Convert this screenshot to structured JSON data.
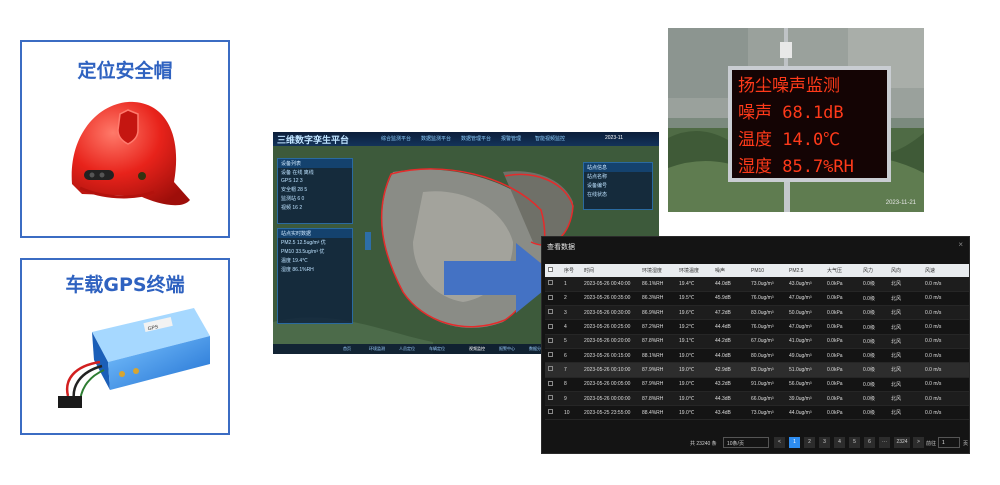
{
  "cards": {
    "helmet_title": "定位安全帽",
    "gps_title": "车载GPS终端",
    "gps_device_label": "GPS"
  },
  "platform": {
    "title": "三维数字孪生平台",
    "nav_tabs": [
      "综合监测平台",
      "数据监测平台",
      "数据管理平台",
      "报警管理",
      "智能视频监控"
    ],
    "date": "2023-11",
    "left_panel_title": "设备列表",
    "left_panel_rows": [
      "设备  在线  离线",
      "GPS  12  3",
      "安全帽  28  5",
      "监测站  6  0",
      "视频  16  2"
    ],
    "left_panel2_title": "站点实时数据",
    "left_panel2_rows": [
      "PM2.5  12.5ug/m³  优",
      "PM10  33.5ug/m³  优",
      "温度  19.4℃",
      "湿度  86.1%RH"
    ],
    "right_panel_title": "站点信息",
    "right_panel_rows": [
      "站点名称",
      "设备编号",
      "在线状态"
    ],
    "bottom_tabs": [
      "首页",
      "环境监测",
      "人员定位",
      "车辆定位",
      "视频监控",
      "报警中心",
      "数据分析"
    ]
  },
  "monitor": {
    "led_lines": [
      "扬尘噪声监测",
      "噪声  68.1dB",
      "温度  14.0℃",
      "湿度  85.7%RH"
    ],
    "watermark": "2023-11-21"
  },
  "datawin": {
    "title": "查看数据",
    "close_icon": "×",
    "columns": [
      "序号",
      "时间",
      "环境湿度",
      "环境温度",
      "噪声",
      "PM10",
      "PM2.5",
      "大气压",
      "风力",
      "风向",
      "风速"
    ],
    "rows": [
      [
        "1",
        "2023-05-26 00:40:00",
        "86.1%RH",
        "19.4℃",
        "44.0dB",
        "73.0ug/m³",
        "43.0ug/m³",
        "0.0kPa",
        "0.0级",
        "北风",
        "0.0 m/s"
      ],
      [
        "2",
        "2023-05-26 00:35:00",
        "86.3%RH",
        "19.5℃",
        "45.9dB",
        "76.0ug/m³",
        "47.0ug/m³",
        "0.0kPa",
        "0.0级",
        "北风",
        "0.0 m/s"
      ],
      [
        "3",
        "2023-05-26 00:30:00",
        "86.9%RH",
        "19.6℃",
        "47.2dB",
        "83.0ug/m³",
        "50.0ug/m³",
        "0.0kPa",
        "0.0级",
        "北风",
        "0.0 m/s"
      ],
      [
        "4",
        "2023-05-26 00:25:00",
        "87.2%RH",
        "19.2℃",
        "44.4dB",
        "76.0ug/m³",
        "47.0ug/m³",
        "0.0kPa",
        "0.0级",
        "北风",
        "0.0 m/s"
      ],
      [
        "5",
        "2023-05-26 00:20:00",
        "87.8%RH",
        "19.1℃",
        "44.2dB",
        "67.0ug/m³",
        "41.0ug/m³",
        "0.0kPa",
        "0.0级",
        "北风",
        "0.0 m/s"
      ],
      [
        "6",
        "2023-05-26 00:15:00",
        "88.1%RH",
        "19.0℃",
        "44.0dB",
        "80.0ug/m³",
        "49.0ug/m³",
        "0.0kPa",
        "0.0级",
        "北风",
        "0.0 m/s"
      ],
      [
        "7",
        "2023-05-26 00:10:00",
        "87.9%RH",
        "19.0℃",
        "42.9dB",
        "82.0ug/m³",
        "51.0ug/m³",
        "0.0kPa",
        "0.0级",
        "北风",
        "0.0 m/s"
      ],
      [
        "8",
        "2023-05-26 00:05:00",
        "87.9%RH",
        "19.0℃",
        "43.2dB",
        "91.0ug/m³",
        "56.0ug/m³",
        "0.0kPa",
        "0.0级",
        "北风",
        "0.0 m/s"
      ],
      [
        "9",
        "2023-05-26 00:00:00",
        "87.8%RH",
        "19.0℃",
        "44.3dB",
        "66.0ug/m³",
        "39.0ug/m³",
        "0.0kPa",
        "0.0级",
        "北风",
        "0.0 m/s"
      ],
      [
        "10",
        "2023-05-25 23:55:00",
        "88.4%RH",
        "19.0℃",
        "43.4dB",
        "73.0ug/m³",
        "44.0ug/m³",
        "0.0kPa",
        "0.0级",
        "北风",
        "0.0 m/s"
      ]
    ],
    "pager": {
      "total": "共 23240 条",
      "page_size": "10条/页",
      "prev": "<",
      "pages": [
        "1",
        "2",
        "3",
        "4",
        "5",
        "6",
        "···",
        "2324"
      ],
      "next": ">",
      "goto_label": "前往",
      "goto_value": "1",
      "goto_unit": "页"
    }
  }
}
